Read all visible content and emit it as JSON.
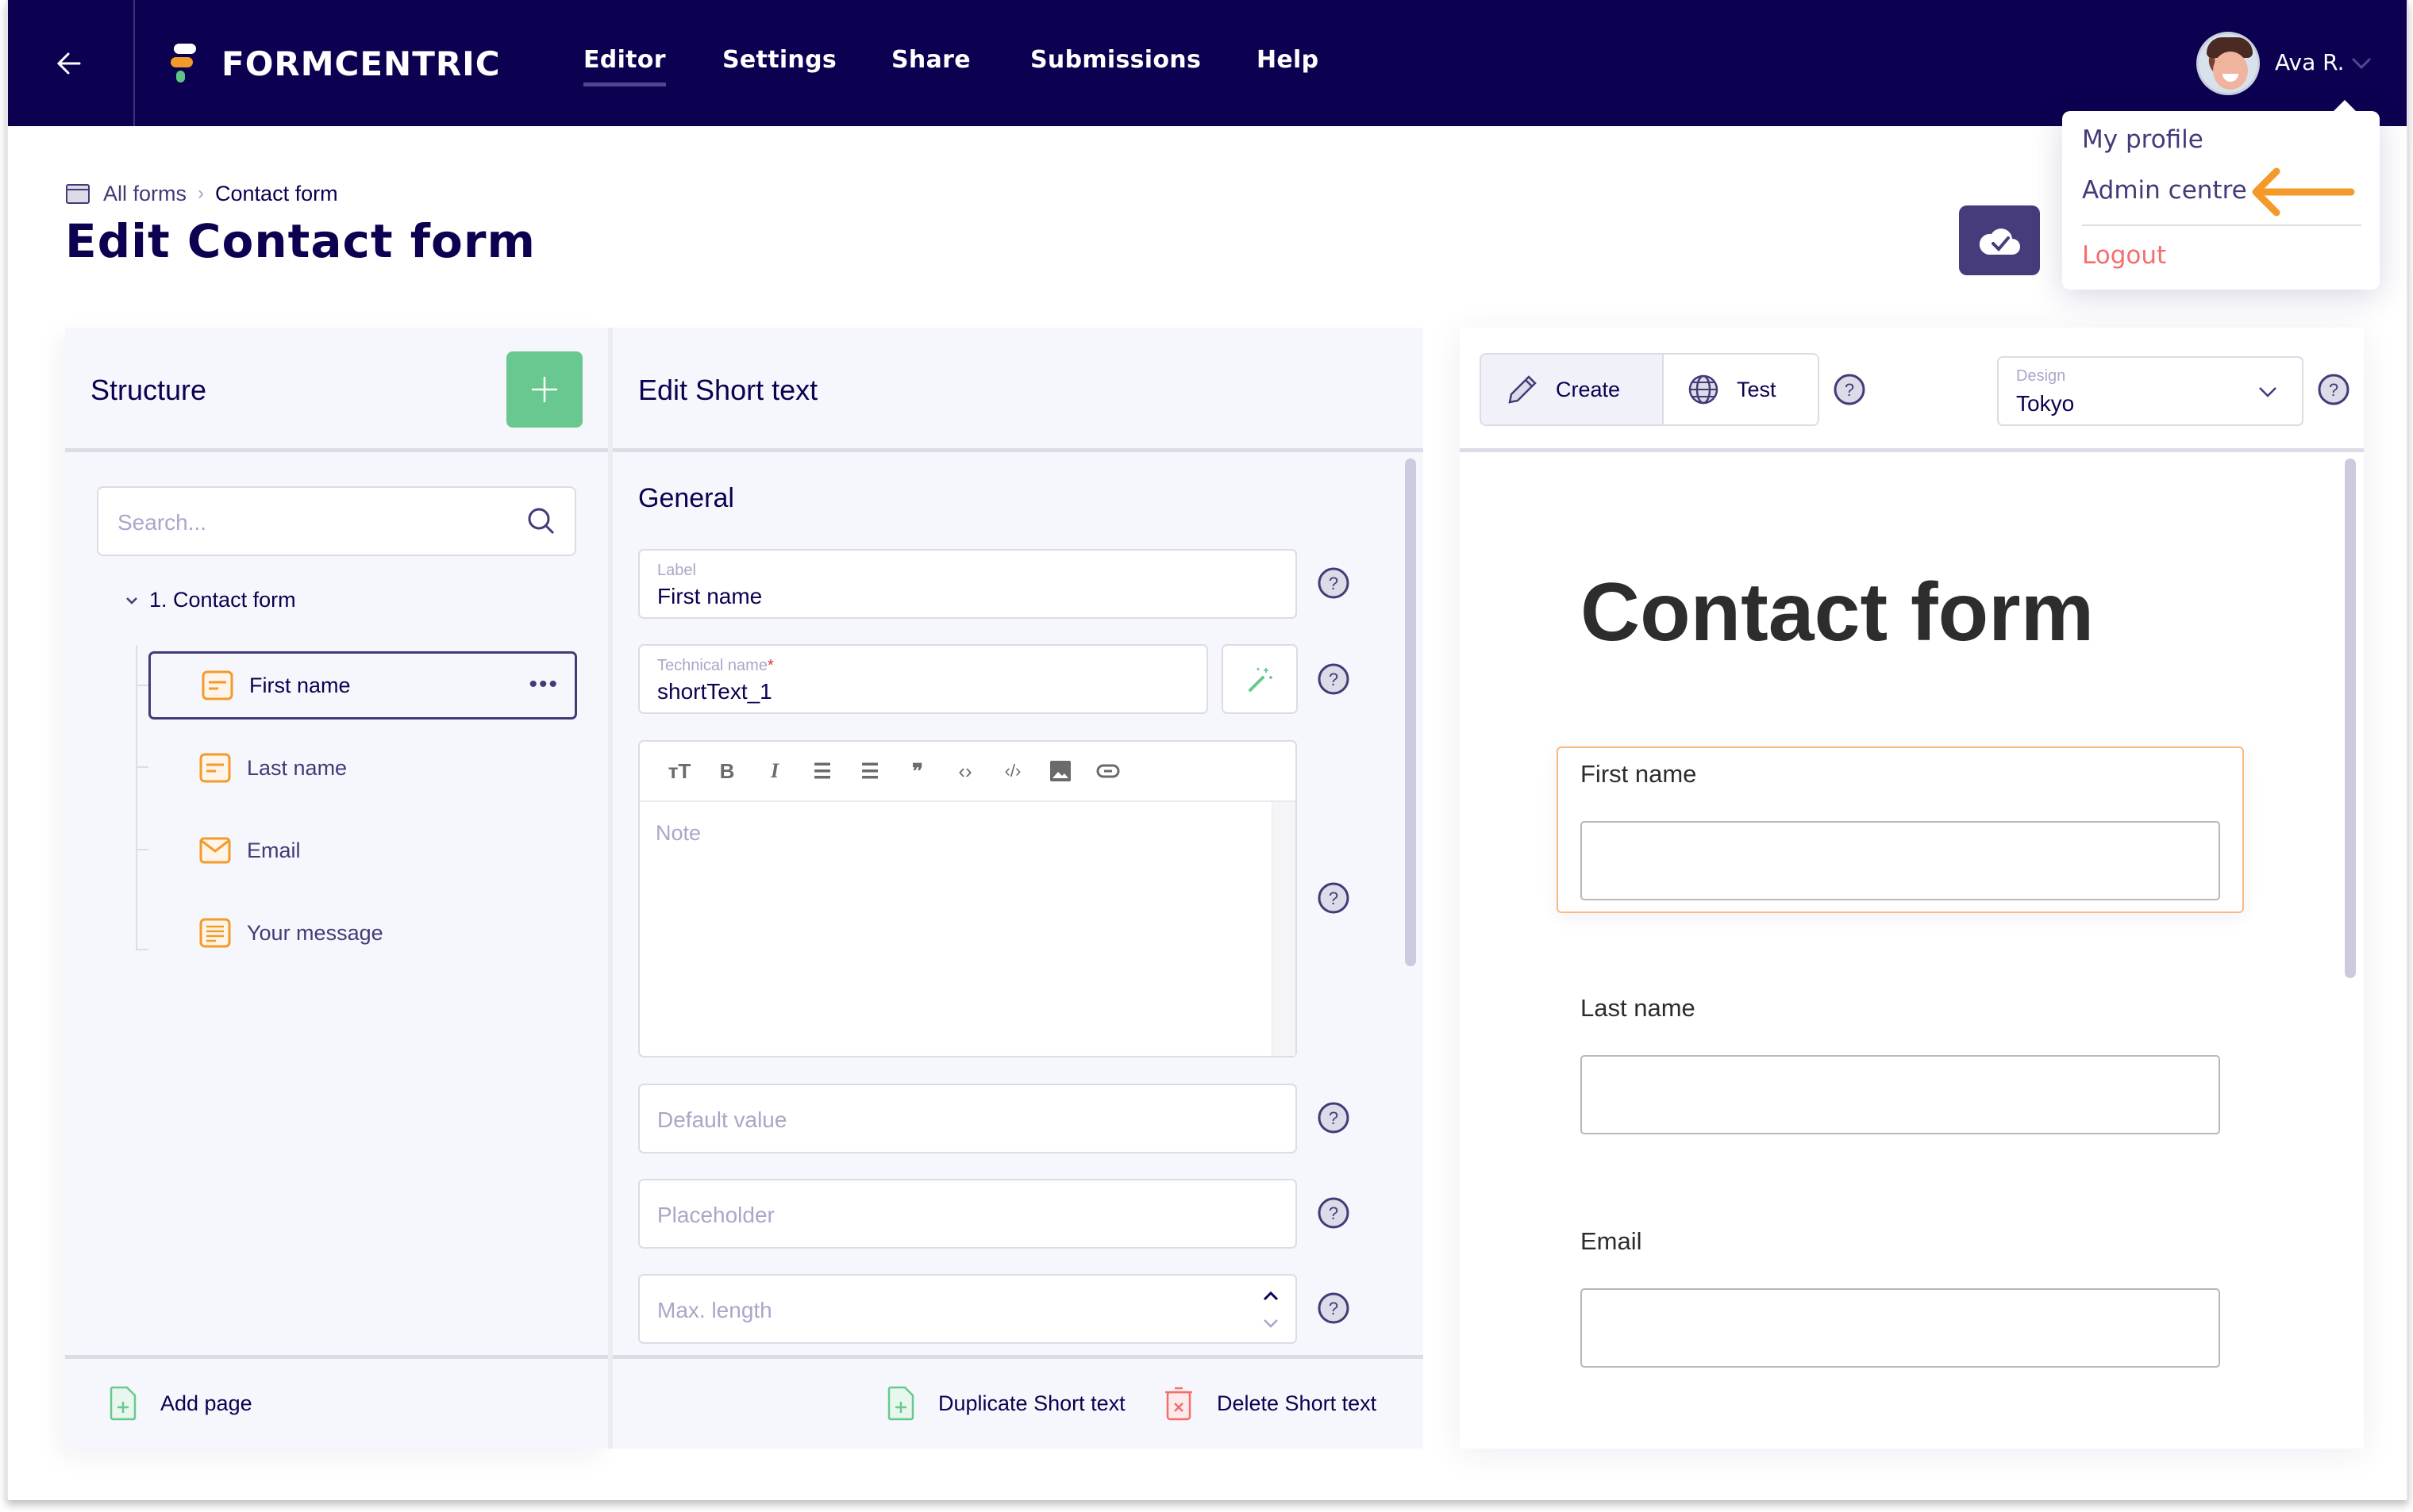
{
  "nav": {
    "brand": "FORMCENTRIC",
    "items": [
      {
        "label": "Editor",
        "active": true
      },
      {
        "label": "Settings",
        "active": false
      },
      {
        "label": "Share",
        "active": false
      },
      {
        "label": "Submissions",
        "active": false
      },
      {
        "label": "Help",
        "active": false
      }
    ],
    "user": {
      "name": "Ava R."
    },
    "icons": {
      "back": "arrow-left-icon",
      "caret": "chevron-down-icon"
    }
  },
  "user_menu": {
    "items": [
      {
        "label": "My profile"
      },
      {
        "label": "Admin centre",
        "highlighted": true
      },
      {
        "label": "Logout",
        "danger": true
      }
    ],
    "annotation_color": "#f39a2b"
  },
  "breadcrumb": {
    "root": "All forms",
    "current": "Contact form"
  },
  "page": {
    "title": "Edit Contact form",
    "save_status_icon": "cloud-check-icon"
  },
  "structure": {
    "title": "Structure",
    "search_placeholder": "Search...",
    "page_label": "1. Contact form",
    "items": [
      {
        "label": "First name",
        "type": "short-text",
        "selected": true
      },
      {
        "label": "Last name",
        "type": "short-text",
        "selected": false
      },
      {
        "label": "Email",
        "type": "email",
        "selected": false
      },
      {
        "label": "Your message",
        "type": "long-text",
        "selected": false
      }
    ],
    "footer_action": "Add page"
  },
  "editor": {
    "title": "Edit Short text",
    "section": "General",
    "label_field": {
      "label": "Label",
      "value": "First name"
    },
    "technical_name_field": {
      "label": "Technical name",
      "required_mark": "*",
      "value": "shortText_1"
    },
    "note_placeholder": "Note",
    "rte_tools": [
      "text-size",
      "bold",
      "italic",
      "bullet-list",
      "numbered-list",
      "quote",
      "code",
      "code-block",
      "image",
      "link"
    ],
    "default_value_placeholder": "Default value",
    "placeholder_placeholder": "Placeholder",
    "max_length_placeholder": "Max. length",
    "footer_actions": {
      "duplicate": "Duplicate Short text",
      "delete": "Delete Short text"
    }
  },
  "preview": {
    "modes": [
      {
        "label": "Create",
        "active": true
      },
      {
        "label": "Test",
        "active": false
      }
    ],
    "design": {
      "label": "Design",
      "value": "Tokyo"
    },
    "form_title": "Contact form",
    "fields": [
      {
        "label": "First name",
        "highlighted": true
      },
      {
        "label": "Last name",
        "highlighted": false
      },
      {
        "label": "Email",
        "highlighted": false
      }
    ]
  },
  "colors": {
    "nav_bg": "#0c0050",
    "accent_purple": "#463c7c",
    "green": "#69c88f",
    "orange": "#f39a2b",
    "danger": "#f46e6c"
  }
}
